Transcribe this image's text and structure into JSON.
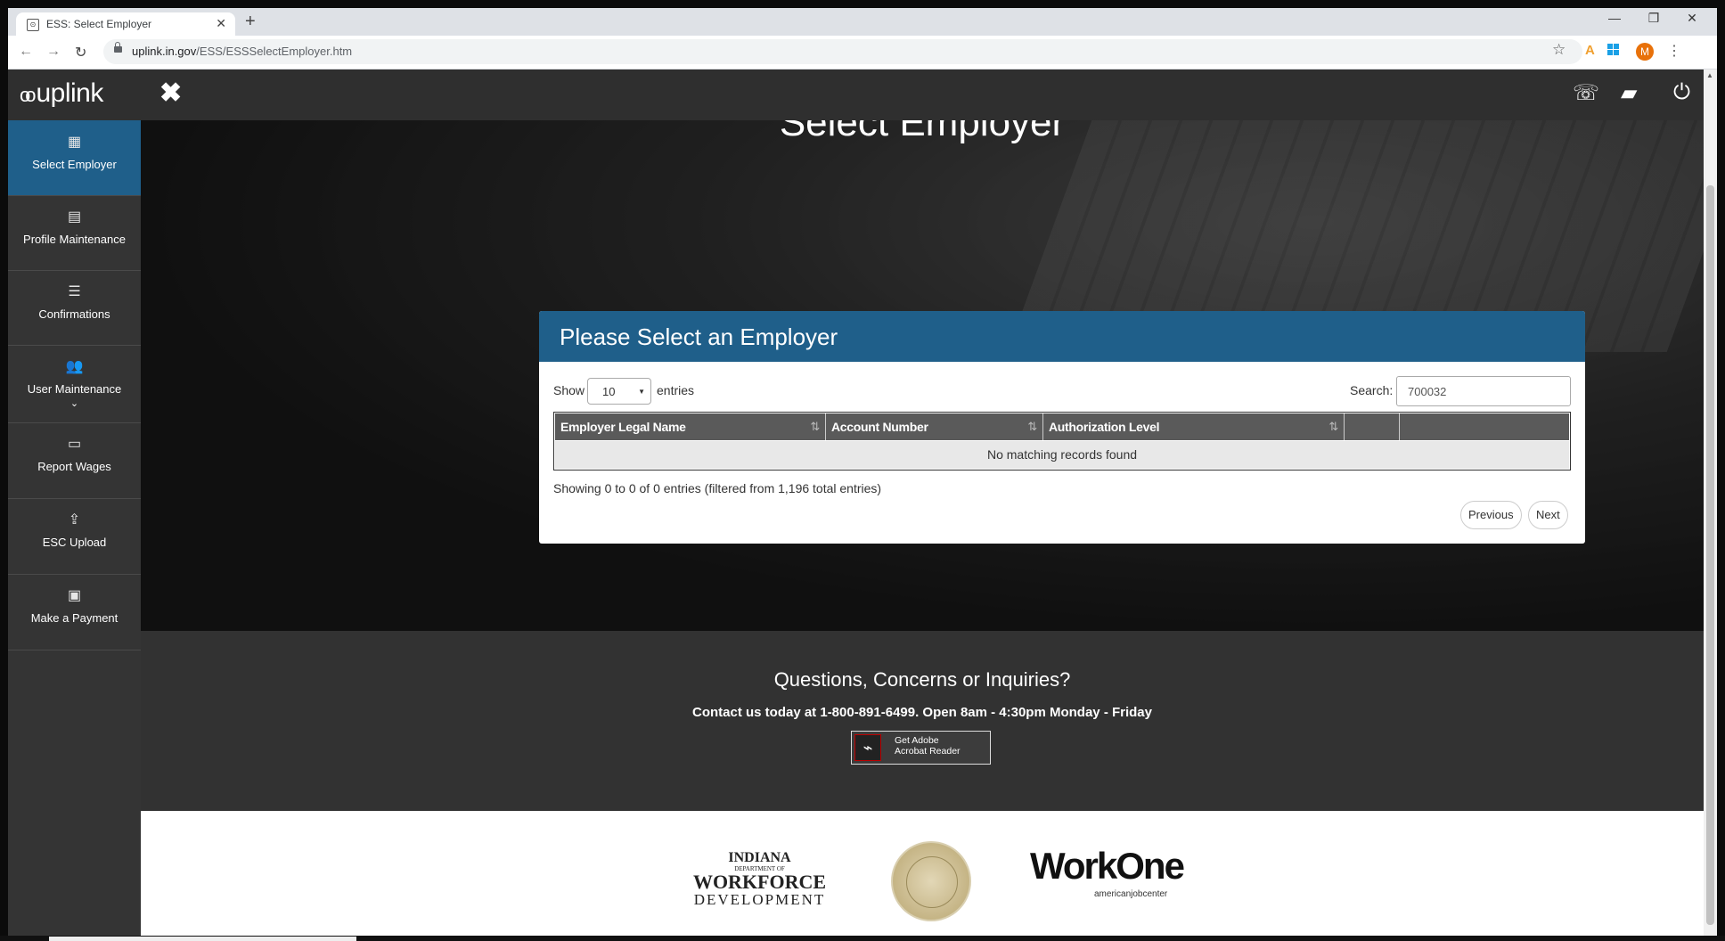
{
  "browser": {
    "tab_title": "ESS: Select Employer",
    "tab_close": "✕",
    "new_tab": "+",
    "url_host": "uplink.in.gov",
    "url_path": "/ESS/ESSSelectEmployer.htm",
    "profile_initial": "M",
    "window_minimize": "—",
    "window_restore": "❐",
    "window_close": "✕"
  },
  "app": {
    "logo": "uplink",
    "close_symbol": "✖"
  },
  "sidebar": {
    "items": [
      {
        "label": "Select Employer",
        "icon": "building-icon",
        "glyph": "▦"
      },
      {
        "label": "Profile Maintenance",
        "icon": "document-icon",
        "glyph": "▤"
      },
      {
        "label": "Confirmations",
        "icon": "list-icon",
        "glyph": "☰"
      },
      {
        "label": "User Maintenance",
        "icon": "users-icon",
        "glyph": "👥",
        "chevron": "⌄"
      },
      {
        "label": "Report Wages",
        "icon": "card-icon",
        "glyph": "▭"
      },
      {
        "label": "ESC Upload",
        "icon": "upload-icon",
        "glyph": "⇪"
      },
      {
        "label": "Make a Payment",
        "icon": "money-icon",
        "glyph": "▣"
      }
    ]
  },
  "hero": {
    "title": "Select Employer"
  },
  "panel": {
    "title": "Please Select an Employer",
    "show_label": "Show",
    "page_size": "10",
    "entries_label": "entries",
    "search_label": "Search:",
    "search_value": "700032",
    "columns": [
      "Employer Legal Name",
      "Account Number",
      "Authorization Level",
      "",
      ""
    ],
    "sort_glyph": "⇅",
    "empty_message": "No matching records found",
    "info": "Showing 0 to 0 of 0 entries (filtered from 1,196 total entries)",
    "previous": "Previous",
    "next": "Next"
  },
  "contact": {
    "heading": "Questions, Concerns or Inquiries?",
    "text": "Contact us today at 1-800-891-6499. Open 8am - 4:30pm Monday - Friday",
    "adobe_line1": "Get Adobe",
    "adobe_line2": "Acrobat Reader"
  },
  "footer": {
    "idwd_1": "INDIANA",
    "idwd_2": "DEPARTMENT OF",
    "idwd_3": "WORKFORCE",
    "idwd_4": "DEVELOPMENT",
    "workone": "WorkOne",
    "workone_sub": "americanjobcenter"
  },
  "colors": {
    "brand_blue": "#1f5f8a",
    "nav_dark": "#2f2f2f"
  }
}
